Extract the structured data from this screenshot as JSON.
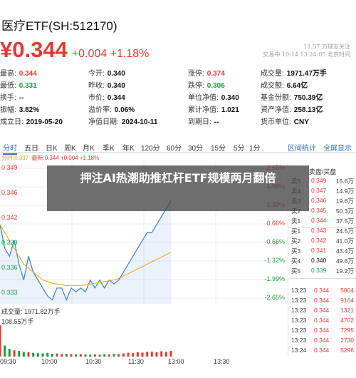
{
  "header": {
    "title": "医疗ETF(SH:512170)",
    "watermark_line1": "11.57 万球友关注",
    "watermark_line2": "交易中 10-14 13:24:05 北京时间",
    "price": "¥0.344",
    "change": "+0.004 +1.18%"
  },
  "stats": [
    [
      {
        "label": "最高:",
        "value": "0.344",
        "color": "red"
      },
      {
        "label": "今开:",
        "value": "0.340",
        "color": "dark"
      },
      {
        "label": "涨停:",
        "value": "0.374",
        "color": "red"
      },
      {
        "label": "成交量:",
        "value": "1971.47万手",
        "color": "dark"
      }
    ],
    [
      {
        "label": "最低:",
        "value": "0.331",
        "color": "green"
      },
      {
        "label": "昨收:",
        "value": "0.340",
        "color": "dark"
      },
      {
        "label": "跌停:",
        "value": "0.306",
        "color": "green"
      },
      {
        "label": "成交额:",
        "value": "6.64亿",
        "color": "dark"
      }
    ],
    [
      {
        "label": "换手:",
        "value": "--",
        "color": "dark"
      },
      {
        "label": "市价:",
        "value": "0.344",
        "color": "dark"
      },
      {
        "label": "单位净值:",
        "value": "0.340",
        "color": "dark"
      },
      {
        "label": "基金份额:",
        "value": "750.39亿",
        "color": "dark"
      }
    ],
    [
      {
        "label": "振幅:",
        "value": "3.82%",
        "color": "dark"
      },
      {
        "label": "溢价率:",
        "value": "0.06%",
        "color": "dark"
      },
      {
        "label": "累计净值:",
        "value": "1.021",
        "color": "dark"
      },
      {
        "label": "资产净值:",
        "value": "258.13亿",
        "color": "dark"
      }
    ],
    [
      {
        "label": "成立日:",
        "value": "2019-05-20",
        "color": "dark"
      },
      {
        "label": "净值日期:",
        "value": "2024-10-11",
        "color": "dark"
      },
      {
        "label": "到期日:",
        "value": "--",
        "color": "dark"
      },
      {
        "label": "货币单位:",
        "value": "CNY",
        "color": "dark"
      }
    ]
  ],
  "tabs": [
    "分时",
    "五日",
    "日K",
    "周K",
    "月K",
    "季K",
    "年K",
    "120分",
    "60分",
    "30分",
    "15分",
    "5分",
    "1分"
  ],
  "tabs_right": [
    "区间统计",
    "全屏显示"
  ],
  "chart_info": {
    "prefix": "分时:0.337",
    "latest": "最新:0.344 +0.004 +1.18%"
  },
  "chart_data": {
    "type": "line",
    "y_left": [
      "0.349",
      "0.346",
      "0.342",
      "0.339",
      "0.336",
      "0.333"
    ],
    "y_right": [
      "2.65%",
      "1.99%",
      "1.32%",
      "0.66%",
      "-0.66%",
      "-1.32%",
      "-1.99%",
      "-2.65%"
    ],
    "x_labels": [
      "09:30",
      "10:00",
      "10:30",
      "11:30",
      "13:00",
      "13:30"
    ],
    "ylim": [
      0.331,
      0.349
    ],
    "series": [
      {
        "values": [
          0.341,
          0.338,
          0.337,
          0.339,
          0.336,
          0.334,
          0.337,
          0.335,
          0.334,
          0.333,
          0.332,
          0.3315,
          0.333,
          0.333,
          0.3315,
          0.333,
          0.3325,
          0.333,
          0.3325,
          0.334,
          0.333,
          0.334,
          0.333,
          0.334,
          0.3335,
          0.334,
          0.335,
          0.336,
          0.337,
          0.338,
          0.339,
          0.34,
          0.34,
          0.341,
          0.342,
          0.343,
          0.344
        ]
      },
      {
        "values": [
          0.341,
          0.34,
          0.339,
          0.338,
          0.337,
          0.336,
          0.3355,
          0.335,
          0.3345,
          0.334,
          0.3338,
          0.3336,
          0.3335,
          0.3334,
          0.3333,
          0.3333,
          0.3333,
          0.3333,
          0.3334,
          0.3335,
          0.3336,
          0.3337,
          0.3338,
          0.3339,
          0.334,
          0.3342,
          0.3345,
          0.3348,
          0.3351,
          0.3354,
          0.3357,
          0.336,
          0.3363,
          0.3366,
          0.3369,
          0.3372,
          0.3375
        ]
      }
    ],
    "volume_label": "成交量: 1971.82万手",
    "volume_max_label": "108.55万手",
    "volume": [
      100,
      35,
      25,
      20,
      18,
      15,
      14,
      12,
      11,
      10,
      12,
      9,
      10,
      8,
      9,
      8,
      7,
      8,
      7,
      6,
      7,
      6,
      8,
      7,
      9,
      8,
      10,
      12,
      11,
      14,
      13,
      15,
      16,
      14,
      17,
      15,
      18
    ]
  },
  "orderbook": {
    "title": "卖盘/买盘",
    "rows": [
      {
        "label": "卖5",
        "price": "0.349",
        "vol": "15.6万",
        "color": "red"
      },
      {
        "label": "卖4",
        "price": "0.347",
        "vol": "14.9万",
        "color": "red"
      },
      {
        "label": "卖3",
        "price": "0.346",
        "vol": "19.6万",
        "color": "red"
      },
      {
        "label": "卖2",
        "price": "0.345",
        "vol": "50.3万",
        "color": "red"
      },
      {
        "label": "卖1",
        "price": "0.344",
        "vol": "37.5万",
        "color": "red"
      },
      {
        "label": "买1",
        "price": "0.343",
        "vol": "24.5万",
        "color": "red"
      },
      {
        "label": "买2",
        "price": "0.342",
        "vol": "41.0万",
        "color": "red"
      },
      {
        "label": "买3",
        "price": "0.341",
        "vol": "43.4万",
        "color": "red"
      },
      {
        "label": "买4",
        "price": "0.340",
        "vol": "49.6万",
        "color": "dark"
      },
      {
        "label": "买5",
        "price": "0.339",
        "vol": "19.2万",
        "color": "green"
      }
    ],
    "trades": [
      {
        "time": "13:23",
        "price": "0.344",
        "vol": "5804"
      },
      {
        "time": "13:23",
        "price": "0.344",
        "vol": "9164"
      },
      {
        "time": "13:23",
        "price": "0.344",
        "vol": "1321"
      },
      {
        "time": "13:23",
        "price": "0.344",
        "vol": "4702"
      },
      {
        "time": "13:23",
        "price": "0.344",
        "vol": "7295"
      },
      {
        "time": "13:23",
        "price": "0.344",
        "vol": "2730"
      },
      {
        "time": "13:24",
        "price": "0.344",
        "vol": "5296"
      }
    ]
  },
  "overlay": {
    "headline": "押注AI热潮助推杠杆ETF规模两月翻倍"
  }
}
